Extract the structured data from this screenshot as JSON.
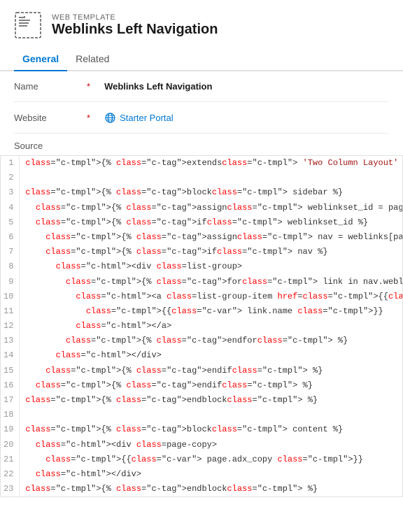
{
  "header": {
    "subtitle": "WEB TEMPLATE",
    "title": "Weblinks Left Navigation"
  },
  "tabs": [
    {
      "id": "general",
      "label": "General",
      "active": true
    },
    {
      "id": "related",
      "label": "Related",
      "active": false
    }
  ],
  "form": {
    "name_label": "Name",
    "name_required": "*",
    "name_value": "Weblinks Left Navigation",
    "website_label": "Website",
    "website_required": "*",
    "website_value": "Starter Portal",
    "source_label": "Source"
  },
  "code": {
    "lines": [
      {
        "num": 1,
        "text": "{% extends 'Two Column Layout' %}"
      },
      {
        "num": 2,
        "text": ""
      },
      {
        "num": 3,
        "text": "{% block sidebar %}"
      },
      {
        "num": 4,
        "text": "  {% assign weblinkset_id = page.adx_navigation.id %}"
      },
      {
        "num": 5,
        "text": "  {% if weblinkset_id %}"
      },
      {
        "num": 6,
        "text": "    {% assign nav = weblinks[page.adx_navigation.id] %}"
      },
      {
        "num": 7,
        "text": "    {% if nav %}"
      },
      {
        "num": 8,
        "text": "      <div class=list-group>"
      },
      {
        "num": 9,
        "text": "        {% for link in nav.weblinks %}"
      },
      {
        "num": 10,
        "text": "          <a class=list-group-item href={{ link.url }}>"
      },
      {
        "num": 11,
        "text": "            {{ link.name }}"
      },
      {
        "num": 12,
        "text": "          </a>"
      },
      {
        "num": 13,
        "text": "        {% endfor %}"
      },
      {
        "num": 14,
        "text": "      </div>"
      },
      {
        "num": 15,
        "text": "    {% endif %}"
      },
      {
        "num": 16,
        "text": "  {% endif %}"
      },
      {
        "num": 17,
        "text": "{% endblock %}"
      },
      {
        "num": 18,
        "text": ""
      },
      {
        "num": 19,
        "text": "{% block content %}"
      },
      {
        "num": 20,
        "text": "  <div class=page-copy>"
      },
      {
        "num": 21,
        "text": "    {{ page.adx_copy }}"
      },
      {
        "num": 22,
        "text": "  </div>"
      },
      {
        "num": 23,
        "text": "{% endblock %}"
      }
    ]
  }
}
